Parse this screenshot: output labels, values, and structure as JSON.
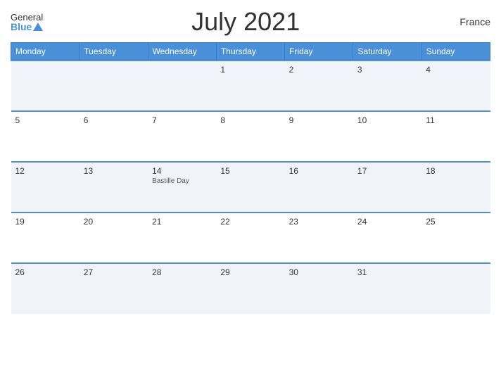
{
  "header": {
    "logo_general": "General",
    "logo_blue": "Blue",
    "title": "July 2021",
    "country": "France"
  },
  "days_of_week": [
    "Monday",
    "Tuesday",
    "Wednesday",
    "Thursday",
    "Friday",
    "Saturday",
    "Sunday"
  ],
  "weeks": [
    [
      {
        "day": "",
        "event": ""
      },
      {
        "day": "",
        "event": ""
      },
      {
        "day": "",
        "event": ""
      },
      {
        "day": "1",
        "event": ""
      },
      {
        "day": "2",
        "event": ""
      },
      {
        "day": "3",
        "event": ""
      },
      {
        "day": "4",
        "event": ""
      }
    ],
    [
      {
        "day": "5",
        "event": ""
      },
      {
        "day": "6",
        "event": ""
      },
      {
        "day": "7",
        "event": ""
      },
      {
        "day": "8",
        "event": ""
      },
      {
        "day": "9",
        "event": ""
      },
      {
        "day": "10",
        "event": ""
      },
      {
        "day": "11",
        "event": ""
      }
    ],
    [
      {
        "day": "12",
        "event": ""
      },
      {
        "day": "13",
        "event": ""
      },
      {
        "day": "14",
        "event": "Bastille Day"
      },
      {
        "day": "15",
        "event": ""
      },
      {
        "day": "16",
        "event": ""
      },
      {
        "day": "17",
        "event": ""
      },
      {
        "day": "18",
        "event": ""
      }
    ],
    [
      {
        "day": "19",
        "event": ""
      },
      {
        "day": "20",
        "event": ""
      },
      {
        "day": "21",
        "event": ""
      },
      {
        "day": "22",
        "event": ""
      },
      {
        "day": "23",
        "event": ""
      },
      {
        "day": "24",
        "event": ""
      },
      {
        "day": "25",
        "event": ""
      }
    ],
    [
      {
        "day": "26",
        "event": ""
      },
      {
        "day": "27",
        "event": ""
      },
      {
        "day": "28",
        "event": ""
      },
      {
        "day": "29",
        "event": ""
      },
      {
        "day": "30",
        "event": ""
      },
      {
        "day": "31",
        "event": ""
      },
      {
        "day": "",
        "event": ""
      }
    ]
  ]
}
